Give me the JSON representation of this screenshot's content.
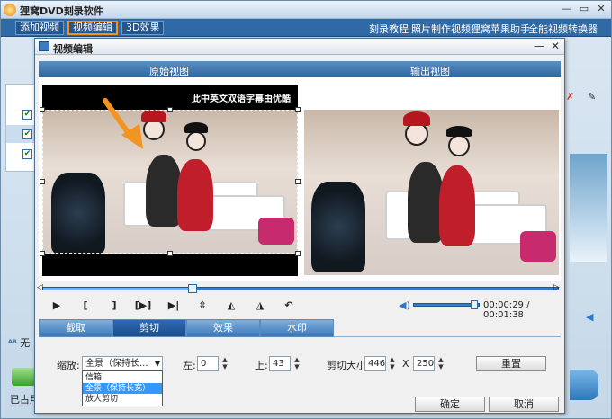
{
  "app": {
    "title": "狸窝DVD刻录软件",
    "toolbar": {
      "add_video": "添加视频",
      "video_edit": "视频编辑",
      "effect_3d": "3D效果",
      "links": [
        "刻录教程",
        "照片制作视频",
        "狸窝苹果助手",
        "全能视频转换器"
      ]
    },
    "status_left": "无",
    "used_label": "已占用"
  },
  "dialog": {
    "title": "视频编辑",
    "panes": {
      "original": "原始视图",
      "output": "输出视图"
    },
    "video": {
      "subtitle": "此中英文双语字幕由优酷"
    },
    "time": "00:00:29 / 00:01:38",
    "seek_fraction": 0.29,
    "volume_fraction": 0.9,
    "controls": [
      "▶",
      "[",
      "]",
      "[▶]",
      "▶|",
      "flip-v",
      "flip-h1",
      "flip-h2",
      "undo"
    ],
    "tabs": [
      "截取",
      "剪切",
      "效果",
      "水印"
    ],
    "active_tab": "剪切",
    "crop": {
      "zoom_label": "缩放:",
      "zoom_value": "全景（保持长...",
      "zoom_options": [
        "信箱",
        "全景（保持长宽）",
        "放大剪切"
      ],
      "left_label": "左:",
      "left_value": "0",
      "top_label": "上:",
      "top_value": "43",
      "size_label": "剪切大小:",
      "width": "446",
      "times": "X",
      "height": "250",
      "reset": "重置"
    },
    "ok": "确定",
    "cancel": "取消"
  },
  "colors": {
    "accent": "#2f6aa6",
    "highlight": "#f2941f",
    "select": "#3399ff"
  }
}
